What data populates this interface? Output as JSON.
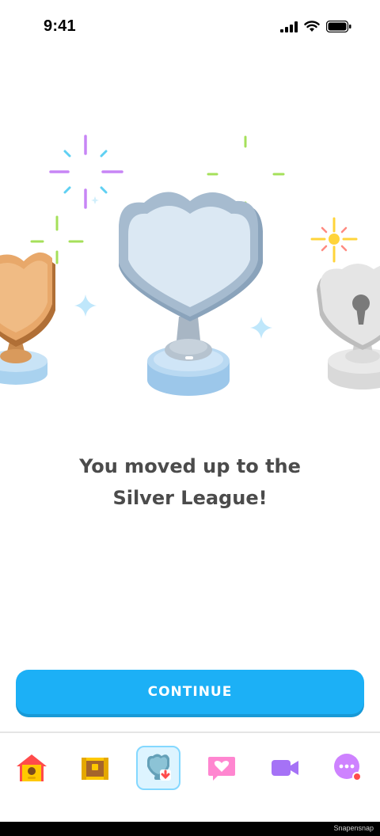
{
  "status_bar": {
    "time": "9:41"
  },
  "content": {
    "headline_line1": "You moved up to the",
    "headline_line2": "Silver League!"
  },
  "actions": {
    "continue_label": "CONTINUE"
  },
  "nav": {
    "tabs": [
      {
        "icon": "home-icon",
        "active": false
      },
      {
        "icon": "treasure-chest-icon",
        "active": false
      },
      {
        "icon": "trophy-league-icon",
        "active": true
      },
      {
        "icon": "heart-speech-icon",
        "active": false
      },
      {
        "icon": "video-camera-icon",
        "active": false
      },
      {
        "icon": "more-dots-icon",
        "active": false,
        "has_notification_dot": true
      }
    ]
  },
  "colors": {
    "primary": "#1cb0f6",
    "primary_shadow": "#1899d6",
    "text": "#4b4b4b",
    "silver": "#d6e3ef",
    "bronze": "#e0a46c"
  },
  "watermark": "Snapensnap"
}
